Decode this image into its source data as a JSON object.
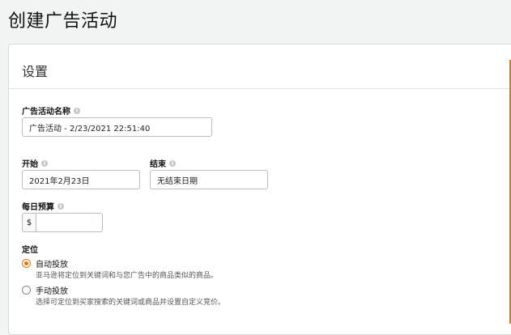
{
  "page_title": "创建广告活动",
  "section": {
    "title": "设置"
  },
  "fields": {
    "campaign_name": {
      "label": "广告活动名称",
      "value": "广告活动 - 2/23/2021 22:51:40"
    },
    "start": {
      "label": "开始",
      "value": "2021年2月23日"
    },
    "end": {
      "label": "结束",
      "value": "无结束日期"
    },
    "daily_budget": {
      "label": "每日预算",
      "prefix": "$",
      "value": ""
    }
  },
  "targeting": {
    "label": "定位",
    "options": [
      {
        "label": "自动投放",
        "description": "亚马逊将定位到关键词和与您广告中的商品类似的商品。",
        "selected": true
      },
      {
        "label": "手动投放",
        "description": "选择可定位到买家搜索的关键词或商品并设置自定义竞价。",
        "selected": false
      }
    ]
  },
  "colors": {
    "accent": "#e77600",
    "border": "#d5d9d9"
  }
}
